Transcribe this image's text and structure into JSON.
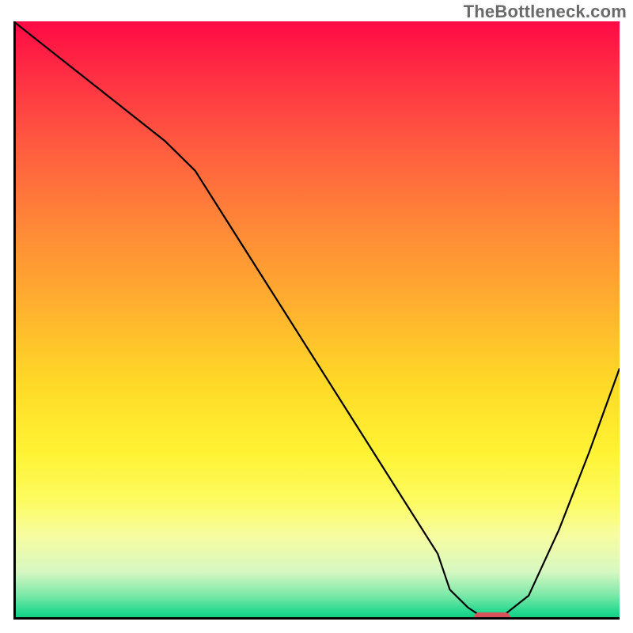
{
  "watermark": "TheBottleneck.com",
  "chart_data": {
    "type": "line",
    "title": "",
    "xlabel": "",
    "ylabel": "",
    "xlim": [
      0,
      100
    ],
    "ylim": [
      0,
      100
    ],
    "x": [
      0,
      5,
      10,
      15,
      20,
      25,
      30,
      35,
      40,
      45,
      50,
      55,
      60,
      65,
      70,
      72,
      75,
      78,
      80,
      85,
      90,
      95,
      100
    ],
    "values": [
      100,
      96,
      92,
      88,
      84,
      80,
      75,
      67,
      59,
      51,
      43,
      35,
      27,
      19,
      11,
      5,
      2,
      0,
      0,
      4,
      15,
      28,
      42
    ],
    "marker": {
      "x": 79,
      "y": 0
    },
    "gradient_stops": [
      {
        "pos": 0,
        "color": "#ff0a45"
      },
      {
        "pos": 33,
        "color": "#ff8438"
      },
      {
        "pos": 60,
        "color": "#ffd827"
      },
      {
        "pos": 80,
        "color": "#fdfb60"
      },
      {
        "pos": 96,
        "color": "#7ae8a7"
      },
      {
        "pos": 100,
        "color": "#0fc87e"
      }
    ]
  }
}
